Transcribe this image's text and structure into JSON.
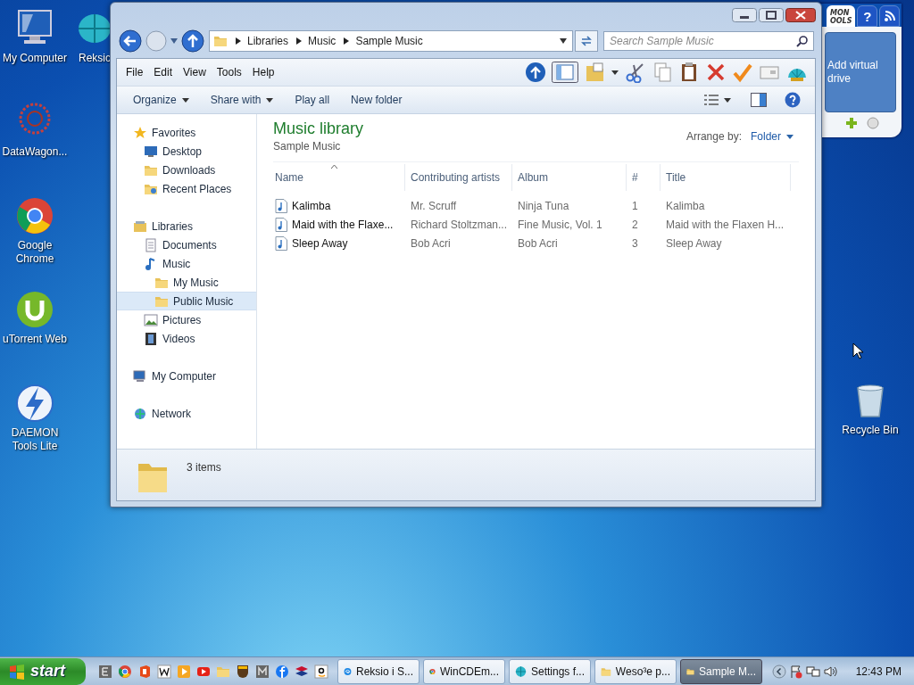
{
  "desktop_icons": [
    {
      "label": "My Computer",
      "kind": "computer"
    },
    {
      "label": "Reksic",
      "kind": "globe"
    },
    {
      "label": "DataWagon...",
      "kind": "flower"
    },
    {
      "label": "Google Chrome",
      "kind": "chrome"
    },
    {
      "label": "uTorrent Web",
      "kind": "torrent"
    },
    {
      "label": "DAEMON Tools Lite",
      "kind": "bolt"
    },
    {
      "label": "Recycle Bin",
      "kind": "bin"
    }
  ],
  "gadget": {
    "logo_lines": [
      "MON",
      "OOLS"
    ],
    "help_tab": "?",
    "add_button": "Add virtual drive"
  },
  "window": {
    "breadcrumb": [
      "Libraries",
      "Music",
      "Sample Music"
    ],
    "search": {
      "placeholder": "Search Sample Music"
    },
    "menu": [
      "File",
      "Edit",
      "View",
      "Tools",
      "Help"
    ],
    "commands": [
      {
        "label": "Organize",
        "dropdown": true
      },
      {
        "label": "Share with",
        "dropdown": true
      },
      {
        "label": "Play all",
        "dropdown": false
      },
      {
        "label": "New folder",
        "dropdown": false
      }
    ],
    "sidebar": [
      {
        "label": "Favorites",
        "kind": "star",
        "selected": false,
        "children": [
          {
            "label": "Desktop",
            "kind": "desktop",
            "selected": false
          },
          {
            "label": "Downloads",
            "kind": "folder",
            "selected": false
          },
          {
            "label": "Recent Places",
            "kind": "recent",
            "selected": false
          }
        ]
      },
      {
        "label": "Libraries",
        "kind": "library",
        "selected": false,
        "children": [
          {
            "label": "Documents",
            "kind": "doc",
            "selected": false
          },
          {
            "label": "Music",
            "kind": "note",
            "selected": false,
            "children": [
              {
                "label": "My Music",
                "kind": "folder",
                "selected": false
              },
              {
                "label": "Public Music",
                "kind": "folder",
                "selected": true
              }
            ]
          },
          {
            "label": "Pictures",
            "kind": "picture",
            "selected": false
          },
          {
            "label": "Videos",
            "kind": "film",
            "selected": false
          }
        ]
      },
      {
        "label": "My Computer",
        "kind": "computer",
        "selected": false
      },
      {
        "label": "Network",
        "kind": "network",
        "selected": false
      }
    ],
    "content": {
      "title": "Music library",
      "subtitle": "Sample Music",
      "arrange_label": "Arrange by:",
      "arrange_value": "Folder",
      "columns": [
        "Name",
        "Contributing artists",
        "Album",
        "#",
        "Title"
      ],
      "rows": [
        [
          "Kalimba",
          "Mr. Scruff",
          "Ninja Tuna",
          "1",
          "Kalimba"
        ],
        [
          "Maid with the Flaxe...",
          "Richard Stoltzman...",
          "Fine Music, Vol. 1",
          "2",
          "Maid with the Flaxen H..."
        ],
        [
          "Sleep Away",
          "Bob Acri",
          "Bob Acri",
          "3",
          "Sleep Away"
        ]
      ]
    },
    "status": "3 items"
  },
  "taskbar": {
    "start": "start",
    "quick_launch": [
      {
        "kind": "e"
      },
      {
        "kind": "chrome"
      },
      {
        "kind": "office"
      },
      {
        "kind": "w"
      },
      {
        "kind": "player"
      },
      {
        "kind": "youtube"
      },
      {
        "kind": "folder"
      },
      {
        "kind": "ups"
      },
      {
        "kind": "m"
      },
      {
        "kind": "facebook"
      },
      {
        "kind": "bank"
      },
      {
        "kind": "amazon"
      }
    ],
    "tasks": [
      {
        "label": "Reksio i S...",
        "kind": "edge",
        "selected": false
      },
      {
        "label": "WinCDEm...",
        "kind": "chrome",
        "selected": false
      },
      {
        "label": "Settings f...",
        "kind": "globe",
        "selected": false
      },
      {
        "label": "Weso³e p...",
        "kind": "folder",
        "selected": false
      },
      {
        "label": "Sample M...",
        "kind": "folder",
        "selected": true
      }
    ],
    "clock": "12:43 PM"
  }
}
